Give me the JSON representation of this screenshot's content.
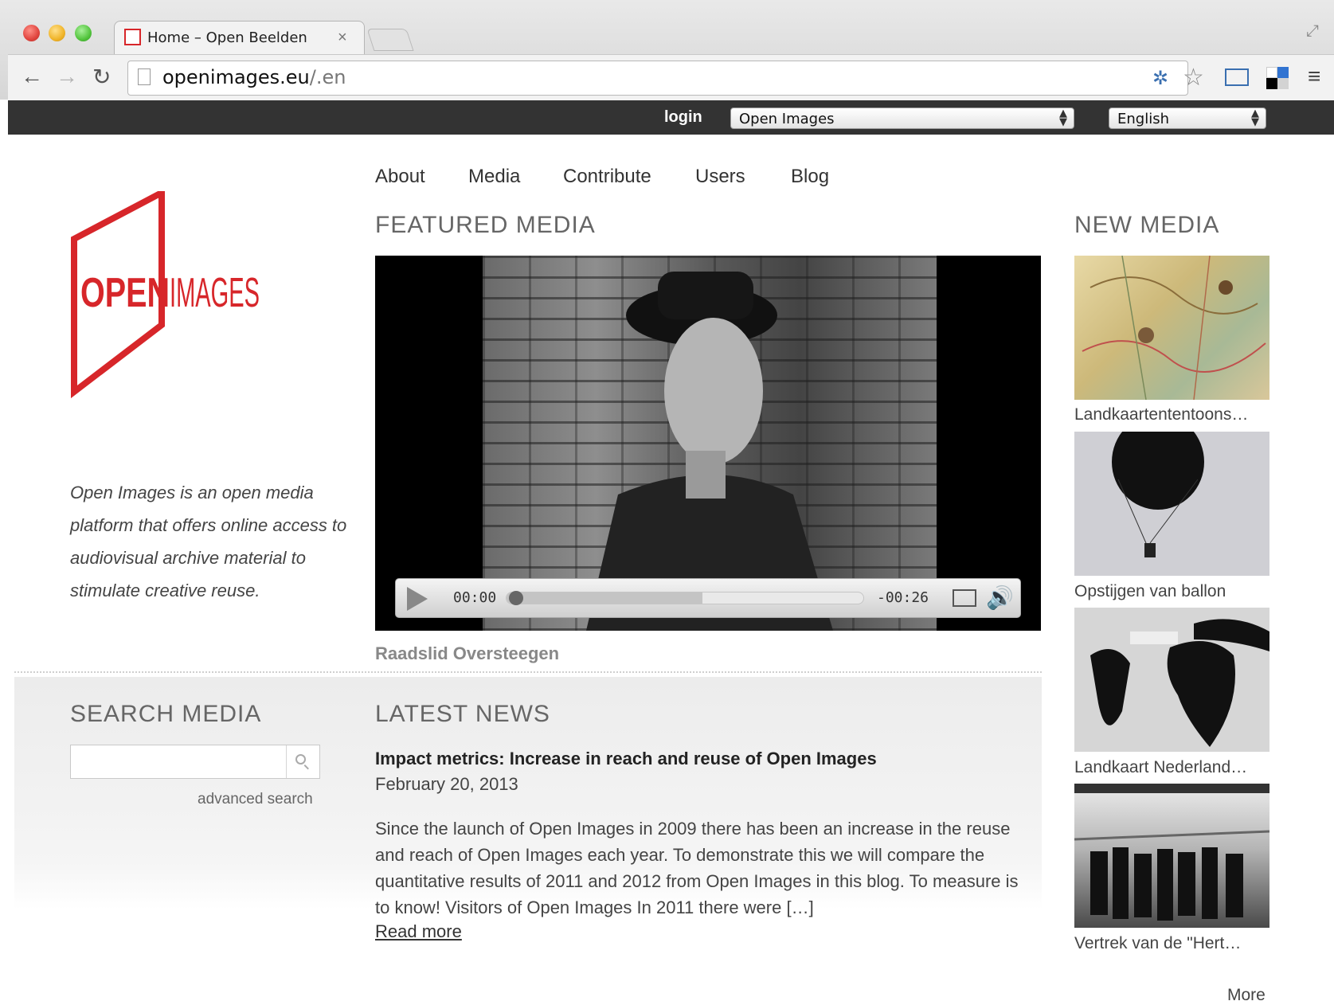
{
  "browser": {
    "tab_title": "Home – Open Beelden",
    "tab_close": "×",
    "url_host": "openimages.eu",
    "url_path": "/.en"
  },
  "site_topbar": {
    "login_label": "login",
    "site_select_value": "Open Images",
    "language_select_value": "English"
  },
  "nav": {
    "items": [
      "About",
      "Media",
      "Contribute",
      "Users",
      "Blog"
    ]
  },
  "logo": {
    "text_bold": "OPEN",
    "text_light": "IMAGES",
    "color": "#d7262a"
  },
  "tagline": "Open Images is an open media platform that offers online access to audiovisual archive material to stimulate creative reuse.",
  "featured": {
    "heading": "FEATURED MEDIA",
    "video_title": "Raadslid Oversteegen",
    "time_current": "00:00",
    "time_remaining": "-00:26",
    "played_fraction": 0.0,
    "buffered_fraction": 0.55
  },
  "search": {
    "heading": "SEARCH MEDIA",
    "input_value": "",
    "advanced_label": "advanced search"
  },
  "news": {
    "heading": "LATEST NEWS",
    "title": "Impact metrics: Increase in reach and reuse of Open Images",
    "date": "February 20, 2013",
    "body": "Since the launch of Open Images in 2009 there has been an increase in the reuse and reach of Open Images each year. To demonstrate this we will compare the quantitative results of 2011 and 2012 from Open Images in this blog. To measure is to know! Visitors of Open Images In 2011 there were […]",
    "read_more": "Read more"
  },
  "new_media": {
    "heading": "NEW MEDIA",
    "items": [
      {
        "label": "Landkaartententoons…"
      },
      {
        "label": "Opstijgen van ballon"
      },
      {
        "label": "Landkaart Nederland…"
      },
      {
        "label": "Vertrek van de \"Hert…"
      }
    ],
    "more_label": "More"
  }
}
